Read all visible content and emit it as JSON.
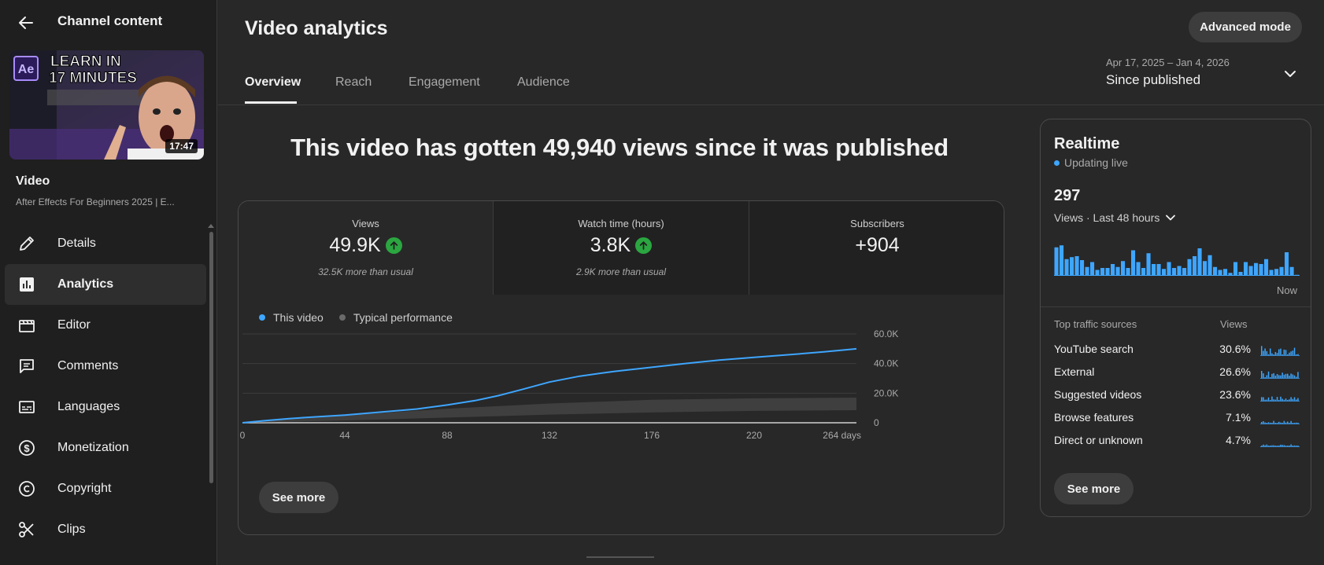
{
  "sidebar": {
    "title": "Channel content",
    "thumbnail": {
      "duration": "17:47",
      "headline_line1": "LEARN IN",
      "headline_line2": "17 MINUTES",
      "app_badge": "Ae"
    },
    "video_label": "Video",
    "video_title": "After Effects For Beginners 2025 | E...",
    "items": [
      {
        "label": "Details",
        "icon": "pencil-icon"
      },
      {
        "label": "Analytics",
        "icon": "analytics-icon"
      },
      {
        "label": "Editor",
        "icon": "clapperboard-icon"
      },
      {
        "label": "Comments",
        "icon": "comment-icon"
      },
      {
        "label": "Languages",
        "icon": "subtitles-icon"
      },
      {
        "label": "Monetization",
        "icon": "dollar-icon"
      },
      {
        "label": "Copyright",
        "icon": "copyright-icon"
      },
      {
        "label": "Clips",
        "icon": "scissors-icon"
      }
    ]
  },
  "header": {
    "title": "Video analytics",
    "advanced_mode": "Advanced mode",
    "tabs": [
      "Overview",
      "Reach",
      "Engagement",
      "Audience"
    ],
    "date_range": "Apr 17, 2025 – Jan 4, 2026",
    "date_label": "Since published"
  },
  "headline": "This video has gotten 49,940 views since it was published",
  "metrics": [
    {
      "label": "Views",
      "value": "49.9K",
      "trend": "up",
      "sub": "32.5K more than usual"
    },
    {
      "label": "Watch time (hours)",
      "value": "3.8K",
      "trend": "up",
      "sub": "2.9K more than usual"
    },
    {
      "label": "Subscribers",
      "value": "+904",
      "trend": "",
      "sub": ""
    }
  ],
  "legend": {
    "this_video": "This video",
    "typical": "Typical performance"
  },
  "see_more": "See more",
  "chart_data": {
    "type": "line",
    "x_unit": "days",
    "xticks": [
      0,
      44,
      88,
      132,
      176,
      220,
      264
    ],
    "xtick_labels": [
      "0",
      "44",
      "88",
      "132",
      "176",
      "220",
      "264 days"
    ],
    "yticks": [
      0,
      20000,
      40000,
      60000
    ],
    "ytick_labels": [
      "0",
      "20.0K",
      "40.0K",
      "60.0K"
    ],
    "ylim": [
      0,
      60000
    ],
    "xlim": [
      0,
      264
    ],
    "series": [
      {
        "name": "This video",
        "color": "#3ea6ff",
        "x": [
          0,
          10,
          20,
          30,
          44,
          60,
          75,
          88,
          100,
          110,
          120,
          132,
          145,
          160,
          176,
          190,
          205,
          220,
          235,
          250,
          264
        ],
        "y": [
          0,
          1500,
          2800,
          3800,
          5200,
          7300,
          9300,
          12000,
          15000,
          18300,
          22400,
          27500,
          31500,
          34700,
          37500,
          40000,
          42300,
          44200,
          46000,
          47900,
          49940
        ]
      }
    ],
    "band": {
      "name": "Typical performance",
      "color": "#3f3f3f",
      "x": [
        0,
        44,
        88,
        132,
        176,
        220,
        264
      ],
      "low": [
        0,
        1500,
        3500,
        5500,
        7000,
        8000,
        8500
      ],
      "high": [
        0,
        5000,
        9500,
        13000,
        15500,
        16500,
        17000
      ]
    }
  },
  "realtime": {
    "title": "Realtime",
    "live": "Updating live",
    "count": "297",
    "period": "Views · Last 48 hours",
    "now": "Now",
    "bars": [
      29,
      31,
      17,
      19,
      20,
      16,
      9,
      14,
      6,
      8,
      8,
      12,
      9,
      15,
      8,
      26,
      14,
      8,
      23,
      12,
      12,
      7,
      14,
      8,
      10,
      8,
      17,
      20,
      28,
      15,
      21,
      9,
      6,
      7,
      3,
      14,
      4,
      14,
      10,
      13,
      12,
      17,
      6,
      7,
      9,
      24,
      9,
      1
    ],
    "top_sources_header": "Top traffic sources",
    "views_header": "Views",
    "sources": [
      {
        "name": "YouTube search",
        "pct": "30.6%"
      },
      {
        "name": "External",
        "pct": "26.6%"
      },
      {
        "name": "Suggested videos",
        "pct": "23.6%"
      },
      {
        "name": "Browse features",
        "pct": "7.1%"
      },
      {
        "name": "Direct or unknown",
        "pct": "4.7%"
      }
    ],
    "see_more": "See more"
  },
  "colors": {
    "accent": "#3ea6ff",
    "up": "#2ba640"
  }
}
